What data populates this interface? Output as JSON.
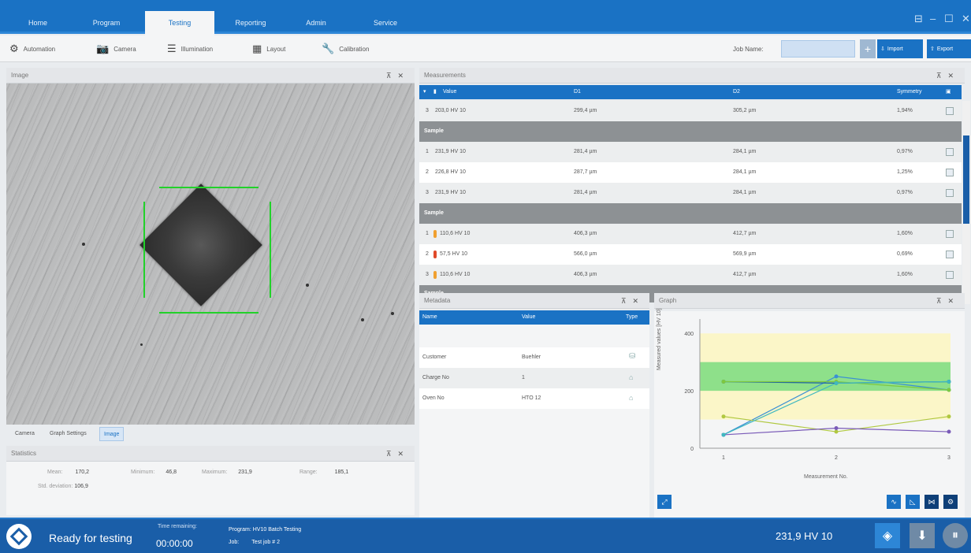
{
  "nav": {
    "tabs": [
      "Home",
      "Program",
      "Testing",
      "Reporting",
      "Admin",
      "Service"
    ],
    "active": "Testing"
  },
  "toolbar": {
    "items": [
      "Automation",
      "Camera",
      "Illumination",
      "Layout",
      "Calibration"
    ],
    "job_name_label": "Job Name:",
    "job_name_value": "",
    "import_label": "Import",
    "export_label": "Export"
  },
  "image_panel": {
    "title": "Image",
    "subtabs": [
      "Camera",
      "Graph Settings",
      "Image"
    ],
    "active_subtab": "Image"
  },
  "statistics": {
    "title": "Statistics",
    "mean_label": "Mean:",
    "mean": "170,2",
    "minimum_label": "Minimum:",
    "minimum": "46,8",
    "maximum_label": "Maximum:",
    "maximum": "231,9",
    "range_label": "Range:",
    "range": "185,1",
    "stddev_label": "Std. deviation:",
    "stddev": "106,9"
  },
  "measurements": {
    "title": "Measurements",
    "columns": [
      "Value",
      "D1",
      "D2",
      "Symmetry"
    ],
    "sample_label": "Sample",
    "first_row": {
      "n": "3",
      "value": "203,0 HV 10",
      "d1": "299,4 µm",
      "d2": "305,2 µm",
      "sym": "1,94%"
    },
    "group1": [
      {
        "n": "1",
        "value": "231,9 HV 10",
        "d1": "281,4 µm",
        "d2": "284,1 µm",
        "sym": "0,97%"
      },
      {
        "n": "2",
        "value": "226,8 HV 10",
        "d1": "287,7 µm",
        "d2": "284,1 µm",
        "sym": "1,25%"
      },
      {
        "n": "3",
        "value": "231,9 HV 10",
        "d1": "281,4 µm",
        "d2": "284,1 µm",
        "sym": "0,97%"
      }
    ],
    "group2": [
      {
        "n": "1",
        "value": "110,6 HV 10",
        "d1": "406,3 µm",
        "d2": "412,7 µm",
        "sym": "1,60%",
        "flag": "#f0a030"
      },
      {
        "n": "2",
        "value": "57,5 HV 10",
        "d1": "566,0 µm",
        "d2": "569,9 µm",
        "sym": "0,69%",
        "flag": "#e04a2a"
      },
      {
        "n": "3",
        "value": "110,6 HV 10",
        "d1": "406,3 µm",
        "d2": "412,7 µm",
        "sym": "1,60%",
        "flag": "#f0a030"
      }
    ]
  },
  "metadata": {
    "title": "Metadata",
    "columns": [
      "Name",
      "Value",
      "Type"
    ],
    "rows": [
      {
        "name": "Customer",
        "value": "Buehler"
      },
      {
        "name": "Charge No",
        "value": "1"
      },
      {
        "name": "Oven No",
        "value": "HTO 12"
      }
    ]
  },
  "graph": {
    "title": "Graph",
    "ylabel": "Measured values [HV 10]",
    "xlabel": "Measurement No.",
    "y_ticks": [
      "400",
      "200",
      "0"
    ],
    "x_ticks": [
      "1",
      "2",
      "3"
    ],
    "ylim": [
      0,
      450
    ],
    "green_band": [
      200,
      300
    ],
    "yellow_band": [
      100,
      400
    ],
    "series": [
      {
        "color": "#3a8fd4",
        "values": [
          46.8,
          250,
          203
        ]
      },
      {
        "color": "#1a5ea8",
        "values": [
          231.9,
          226.8,
          231.9
        ]
      },
      {
        "color": "#7ec840",
        "values": [
          231.9,
          231.9,
          203
        ]
      },
      {
        "color": "#b0c840",
        "values": [
          110.6,
          57.5,
          110.6
        ]
      },
      {
        "color": "#7a5bb8",
        "values": [
          46.8,
          70,
          57.5
        ]
      },
      {
        "color": "#40b8c0",
        "values": [
          46.8,
          226.8,
          231.9
        ]
      }
    ]
  },
  "status": {
    "state": "Ready for testing",
    "time_label": "Time remaining:",
    "time": "00:00:00",
    "program_label": "Program:",
    "program": "HV10 Batch Testing",
    "job_label": "Job:",
    "job": "Test job # 2",
    "last_value": "231,9 HV 10"
  }
}
